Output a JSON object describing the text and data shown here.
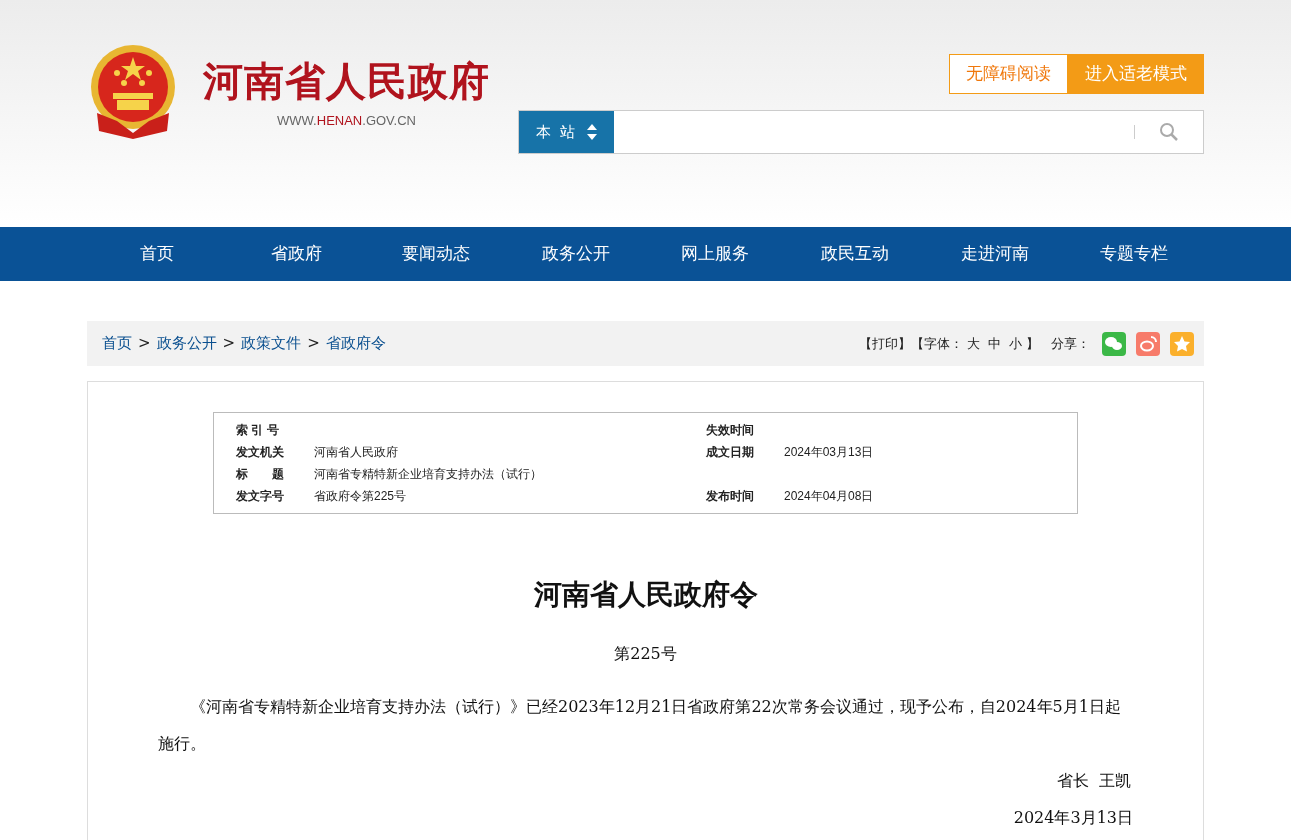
{
  "header": {
    "site_title": "河南省人民政府",
    "site_url_parts": [
      {
        "text": "WWW.",
        "highlight": false
      },
      {
        "text": "HENAN",
        "highlight": true
      },
      {
        "text": ".GOV.CN",
        "highlight": false
      }
    ],
    "mode_buttons": [
      {
        "label": "无障碍阅读",
        "selected": false
      },
      {
        "label": "进入适老模式",
        "selected": true
      }
    ],
    "search": {
      "scope": "本  站"
    }
  },
  "nav": {
    "items": [
      "首页",
      "省政府",
      "要闻动态",
      "政务公开",
      "网上服务",
      "政民互动",
      "走进河南",
      "专题专栏"
    ]
  },
  "breadcrumb": [
    {
      "kind": "link",
      "text": "首页"
    },
    {
      "kind": "separator",
      "text": ">"
    },
    {
      "kind": "link",
      "text": "政务公开"
    },
    {
      "kind": "separator",
      "text": ">"
    },
    {
      "kind": "link",
      "text": "政策文件"
    },
    {
      "kind": "separator",
      "text": ">"
    },
    {
      "kind": "link",
      "text": "省政府令"
    }
  ],
  "tools": {
    "print": "【打印】",
    "font_open": "【字体：",
    "font_sizes": [
      "大",
      "中",
      "小"
    ],
    "font_close": "】",
    "share_label": "分享：",
    "share": [
      {
        "kind": "wechat",
        "color": "#3bb847"
      },
      {
        "kind": "weibo",
        "color": "#f77b6a"
      },
      {
        "kind": "favorite",
        "color": "#fbb02c"
      }
    ]
  },
  "meta": {
    "rows": [
      {
        "label": "索 引 号",
        "value": "",
        "label_2": "失效时间",
        "value_2": ""
      },
      {
        "label": "发文机关",
        "value": "河南省人民政府",
        "label_2": "成文日期",
        "value_2": "2024年03月13日"
      },
      {
        "label": "标　　题",
        "value": "河南省专精特新企业培育支持办法（试行）",
        "label_2": "",
        "value_2": ""
      },
      {
        "label": "发文字号",
        "value": "省政府令第225号",
        "label_2": "发布时间",
        "value_2": "2024年04月08日"
      }
    ]
  },
  "article": {
    "title": "河南省人民政府令",
    "number": "第225号",
    "paragraph": "《河南省专精特新企业培育支持办法（试行）》已经2023年12月21日省政府第22次常务会议通过，现予公布，自2024年5月1日起施行。",
    "signature": "省长  王凯",
    "date": "2024年3月13日"
  }
}
